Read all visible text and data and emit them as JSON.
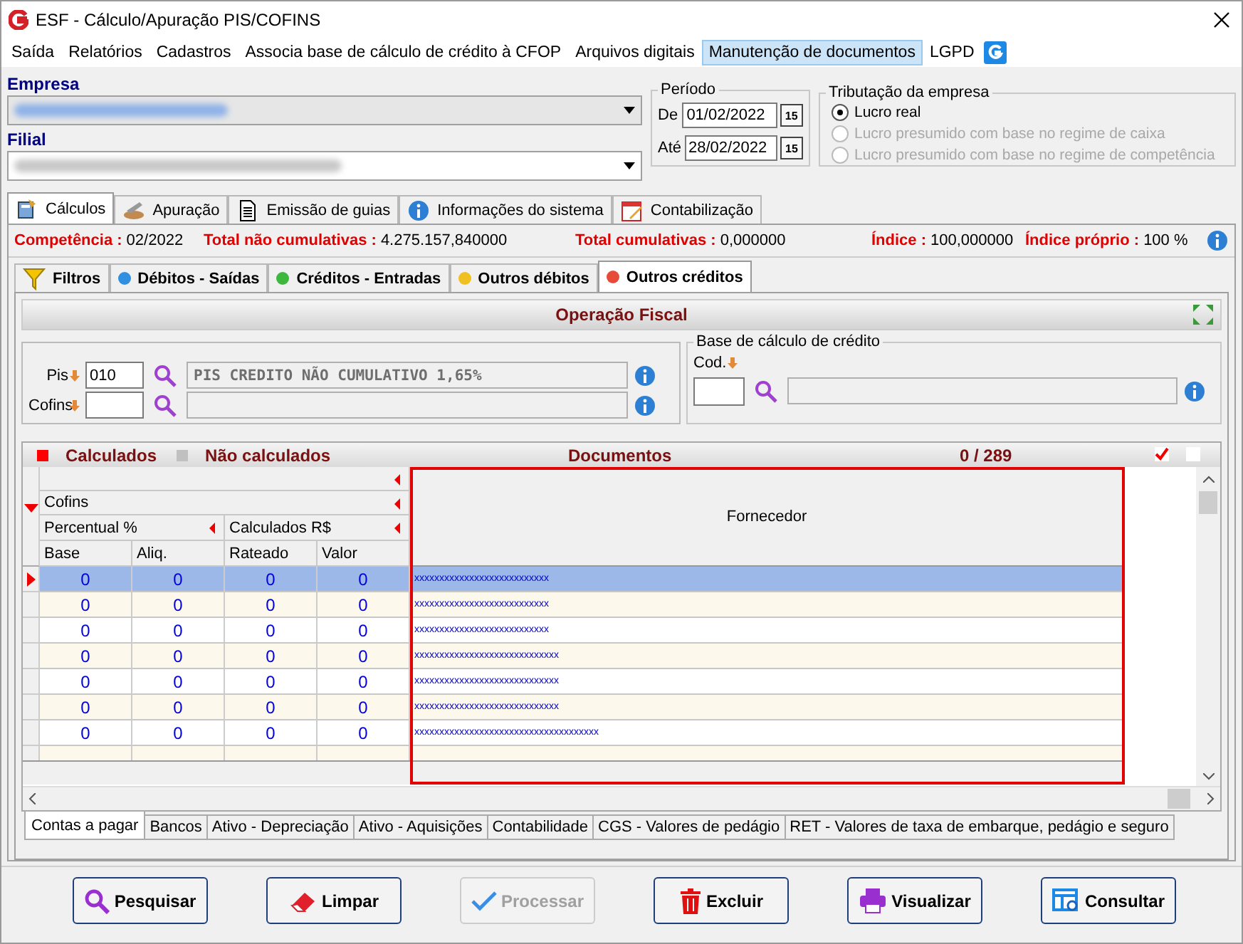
{
  "window": {
    "title": "ESF - Cálculo/Apuração PIS/COFINS"
  },
  "menu": [
    {
      "label": "Saída",
      "selected": false
    },
    {
      "label": "Relatórios",
      "selected": false
    },
    {
      "label": "Cadastros",
      "selected": false
    },
    {
      "label": "Associa base de cálculo de crédito à CFOP",
      "selected": false
    },
    {
      "label": "Arquivos digitais",
      "selected": false
    },
    {
      "label": "Manutenção de documentos",
      "selected": true
    },
    {
      "label": "LGPD",
      "selected": false
    }
  ],
  "empresa": {
    "label": "Empresa"
  },
  "filial": {
    "label": "Filial"
  },
  "periodo": {
    "title": "Período",
    "dates": [
      {
        "label": "De",
        "value": "01/02/2022",
        "picker": "15"
      },
      {
        "label": "Até",
        "value": "28/02/2022",
        "picker": "15"
      }
    ]
  },
  "tributacao": {
    "title": "Tributação da empresa",
    "options": [
      {
        "label": "Lucro real",
        "selected": true,
        "disabled": false
      },
      {
        "label": "Lucro presumido com base no regime de caixa",
        "selected": false,
        "disabled": true
      },
      {
        "label": "Lucro presumido com base no regime de competência",
        "selected": false,
        "disabled": true
      }
    ]
  },
  "main_tabs": [
    {
      "label": "Cálculos",
      "kind": "calc",
      "selected": true
    },
    {
      "label": "Apuração",
      "kind": "apuracao",
      "selected": false
    },
    {
      "label": "Emissão de guias",
      "kind": "doc",
      "selected": false
    },
    {
      "label": "Informações do sistema",
      "kind": "info",
      "selected": false
    },
    {
      "label": "Contabilização",
      "kind": "calendar",
      "selected": false
    }
  ],
  "summary": [
    {
      "label": "Competência :",
      "value": "02/2022"
    },
    {
      "label": "Total não cumulativas :",
      "value": "4.275.157,840000"
    },
    {
      "label": "Total cumulativas :",
      "value": "0,000000"
    },
    {
      "label": "Índice :",
      "value": "100,000000"
    },
    {
      "label": "Índice próprio :",
      "value": "100 %"
    }
  ],
  "sub_tabs": [
    {
      "label": "Filtros",
      "kind": "filter",
      "selected": false
    },
    {
      "label": "Débitos - Saídas",
      "kind": "dot",
      "color": "#2f8fe0",
      "selected": false
    },
    {
      "label": "Créditos - Entradas",
      "kind": "dot",
      "color": "#3cb83c",
      "selected": false
    },
    {
      "label": "Outros débitos",
      "kind": "dot",
      "color": "#f0c020",
      "selected": false
    },
    {
      "label": "Outros créditos",
      "kind": "dot",
      "color": "#e84a3a",
      "selected": true
    }
  ],
  "operacao": {
    "title": "Operação Fiscal",
    "rows": [
      {
        "label": "Pis",
        "code": "010",
        "description": "PIS CREDITO NÃO CUMULATIVO 1,65%"
      },
      {
        "label": "Cofins"
      }
    ],
    "base": {
      "title": "Base de cálculo de crédito",
      "label": "Cod."
    }
  },
  "grid": {
    "legend": [
      {
        "label": "Calculados",
        "color": "#ff0000"
      },
      {
        "label": "Não calculados",
        "color": "#c0c0c0"
      }
    ],
    "title": "Documentos",
    "count": "0 / 289",
    "header_checks": [
      {
        "checked": true
      },
      {
        "checked": false
      }
    ],
    "group": "Cofins",
    "subgroups": [
      "Percentual %",
      "Calculados R$"
    ],
    "columns": [
      "Base",
      "Aliq.",
      "Rateado",
      "Valor"
    ],
    "fornecedor": "Fornecedor",
    "rows": [
      {
        "selected": true,
        "values": [
          "0",
          "0",
          "0",
          "0"
        ],
        "fornecedor": "xxxxxxxxxxxxxxxxxxxxxxxxxxx"
      },
      {
        "selected": false,
        "values": [
          "0",
          "0",
          "0",
          "0"
        ],
        "fornecedor": "xxxxxxxxxxxxxxxxxxxxxxxxxxx"
      },
      {
        "selected": false,
        "values": [
          "0",
          "0",
          "0",
          "0"
        ],
        "fornecedor": "xxxxxxxxxxxxxxxxxxxxxxxxxxx"
      },
      {
        "selected": false,
        "values": [
          "0",
          "0",
          "0",
          "0"
        ],
        "fornecedor": "xxxxxxxxxxxxxxxxxxxxxxxxxxxxx"
      },
      {
        "selected": false,
        "values": [
          "0",
          "0",
          "0",
          "0"
        ],
        "fornecedor": "xxxxxxxxxxxxxxxxxxxxxxxxxxxxx"
      },
      {
        "selected": false,
        "values": [
          "0",
          "0",
          "0",
          "0"
        ],
        "fornecedor": "xxxxxxxxxxxxxxxxxxxxxxxxxxxxx"
      },
      {
        "selected": false,
        "values": [
          "0",
          "0",
          "0",
          "0"
        ],
        "fornecedor": "xxxxxxxxxxxxxxxxxxxxxxxxxxxxxxxxxxxxx"
      }
    ]
  },
  "bottom_tabs": [
    {
      "label": "Contas a pagar",
      "selected": true
    },
    {
      "label": "Bancos",
      "selected": false
    },
    {
      "label": "Ativo - Depreciação",
      "selected": false
    },
    {
      "label": "Ativo - Aquisições",
      "selected": false
    },
    {
      "label": "Contabilidade",
      "selected": false
    },
    {
      "label": "CGS - Valores de pedágio",
      "selected": false
    },
    {
      "label": "RET - Valores de taxa de embarque, pedágio e seguro",
      "selected": false
    }
  ],
  "buttons": [
    {
      "label": "Pesquisar",
      "kind": "search",
      "disabled": false
    },
    {
      "label": "Limpar",
      "kind": "eraser",
      "disabled": false
    },
    {
      "label": "Processar",
      "kind": "check",
      "disabled": true
    },
    {
      "label": "Excluir",
      "kind": "trash",
      "disabled": false
    },
    {
      "label": "Visualizar",
      "kind": "print",
      "disabled": false
    },
    {
      "label": "Consultar",
      "kind": "consult",
      "disabled": false
    }
  ]
}
